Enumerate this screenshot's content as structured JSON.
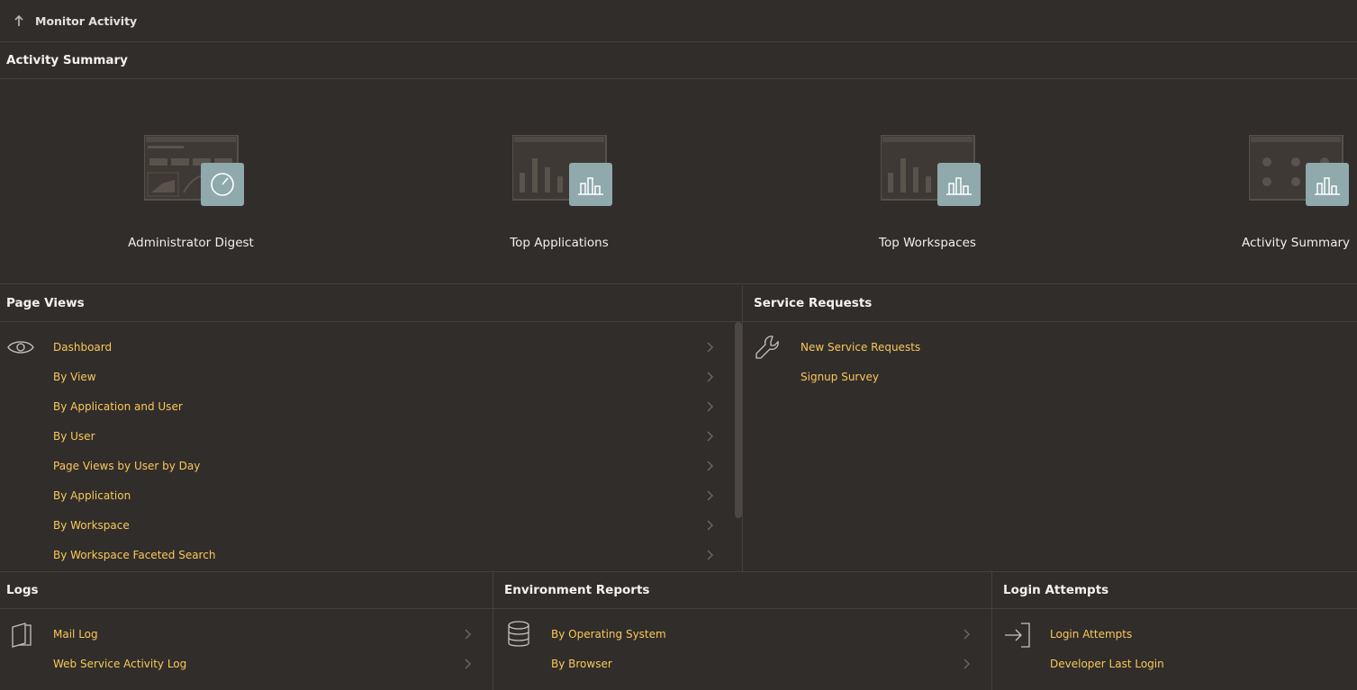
{
  "header": {
    "title": "Monitor Activity"
  },
  "activity_summary": {
    "title": "Activity Summary",
    "cards": [
      {
        "label": "Administrator Digest",
        "icon": "gauge-icon"
      },
      {
        "label": "Top Applications",
        "icon": "bar-chart-icon"
      },
      {
        "label": "Top Workspaces",
        "icon": "bar-chart-icon"
      },
      {
        "label": "Activity Summary",
        "icon": "bar-chart-icon"
      }
    ]
  },
  "page_views": {
    "title": "Page Views",
    "icon": "eye-icon",
    "items": [
      "Dashboard",
      "By View",
      "By Application and User",
      "By User",
      "Page Views by User by Day",
      "By Application",
      "By Workspace",
      "By Workspace Faceted Search"
    ]
  },
  "service_requests": {
    "title": "Service Requests",
    "icon": "wrench-icon",
    "items": [
      "New Service Requests",
      "Signup Survey"
    ]
  },
  "logs": {
    "title": "Logs",
    "icon": "log-book-icon",
    "items": [
      "Mail Log",
      "Web Service Activity Log"
    ]
  },
  "environment_reports": {
    "title": "Environment Reports",
    "icon": "database-icon",
    "items": [
      "By Operating System",
      "By Browser"
    ]
  },
  "login_attempts": {
    "title": "Login Attempts",
    "icon": "sign-in-icon",
    "items": [
      "Login Attempts",
      "Developer Last Login"
    ]
  },
  "colors": {
    "background": "#312d2a",
    "link": "#f9c85a",
    "badge": "#8fa9ad",
    "divider": "#45403c"
  }
}
